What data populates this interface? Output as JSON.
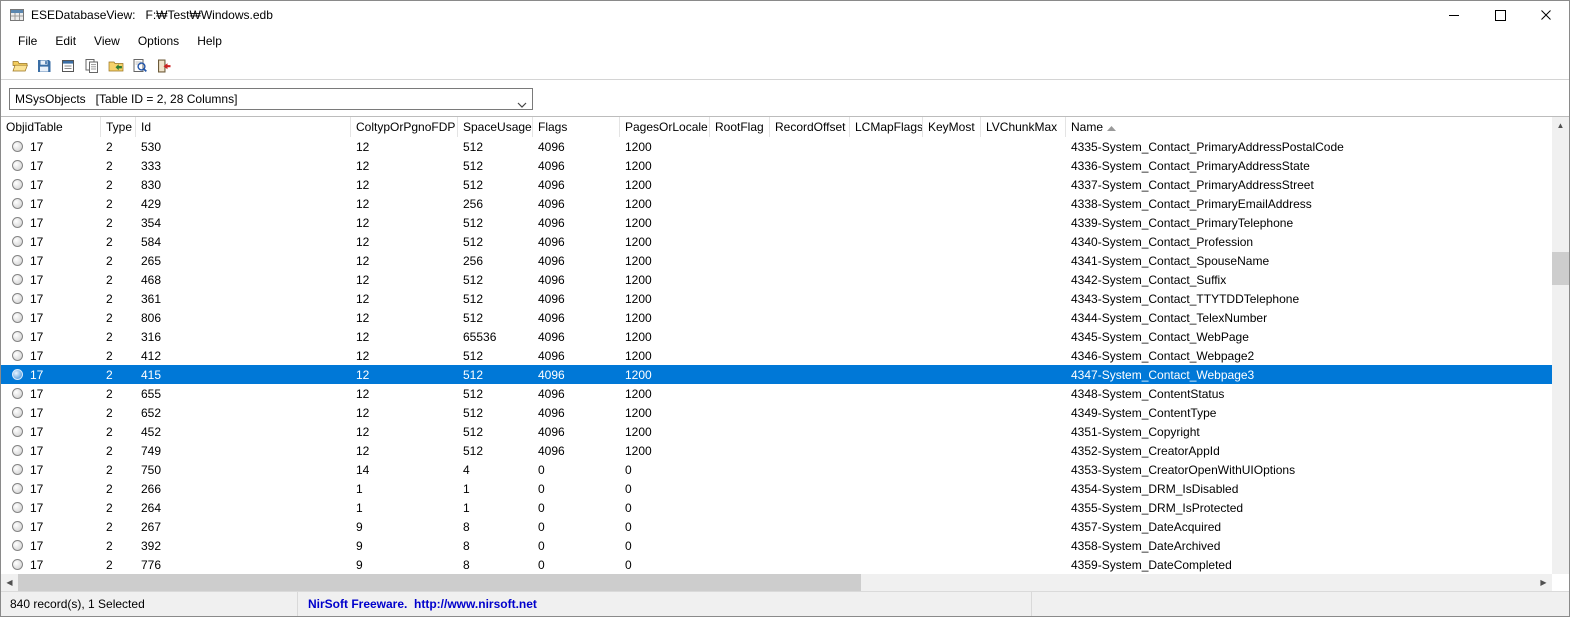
{
  "window": {
    "title": "ESEDatabaseView:   F:₩Test₩Windows.edb"
  },
  "menu": {
    "items": [
      "File",
      "Edit",
      "View",
      "Options",
      "Help"
    ]
  },
  "toolbar": {
    "buttons": [
      "open-file",
      "save-selected-items",
      "database-properties",
      "copy-selected-items",
      "export-selected-items",
      "find",
      "exit"
    ]
  },
  "table_selector": {
    "value": "MSysObjects   [Table ID = 2, 28 Columns]"
  },
  "grid": {
    "columns": [
      "ObjidTable",
      "Type",
      "Id",
      "ColtypOrPgnoFDP",
      "SpaceUsage",
      "Flags",
      "PagesOrLocale",
      "RootFlag",
      "RecordOffset",
      "LCMapFlags",
      "KeyMost",
      "LVChunkMax",
      "Name"
    ],
    "sort_column": "Name",
    "sort_order": "ascending",
    "selected_row_index": 12,
    "rows": [
      [
        "17",
        "2",
        "530",
        "12",
        "512",
        "4096",
        "1200",
        "",
        "",
        "",
        "",
        "",
        "4335-System_Contact_PrimaryAddressPostalCode"
      ],
      [
        "17",
        "2",
        "333",
        "12",
        "512",
        "4096",
        "1200",
        "",
        "",
        "",
        "",
        "",
        "4336-System_Contact_PrimaryAddressState"
      ],
      [
        "17",
        "2",
        "830",
        "12",
        "512",
        "4096",
        "1200",
        "",
        "",
        "",
        "",
        "",
        "4337-System_Contact_PrimaryAddressStreet"
      ],
      [
        "17",
        "2",
        "429",
        "12",
        "256",
        "4096",
        "1200",
        "",
        "",
        "",
        "",
        "",
        "4338-System_Contact_PrimaryEmailAddress"
      ],
      [
        "17",
        "2",
        "354",
        "12",
        "512",
        "4096",
        "1200",
        "",
        "",
        "",
        "",
        "",
        "4339-System_Contact_PrimaryTelephone"
      ],
      [
        "17",
        "2",
        "584",
        "12",
        "512",
        "4096",
        "1200",
        "",
        "",
        "",
        "",
        "",
        "4340-System_Contact_Profession"
      ],
      [
        "17",
        "2",
        "265",
        "12",
        "256",
        "4096",
        "1200",
        "",
        "",
        "",
        "",
        "",
        "4341-System_Contact_SpouseName"
      ],
      [
        "17",
        "2",
        "468",
        "12",
        "512",
        "4096",
        "1200",
        "",
        "",
        "",
        "",
        "",
        "4342-System_Contact_Suffix"
      ],
      [
        "17",
        "2",
        "361",
        "12",
        "512",
        "4096",
        "1200",
        "",
        "",
        "",
        "",
        "",
        "4343-System_Contact_TTYTDDTelephone"
      ],
      [
        "17",
        "2",
        "806",
        "12",
        "512",
        "4096",
        "1200",
        "",
        "",
        "",
        "",
        "",
        "4344-System_Contact_TelexNumber"
      ],
      [
        "17",
        "2",
        "316",
        "12",
        "65536",
        "4096",
        "1200",
        "",
        "",
        "",
        "",
        "",
        "4345-System_Contact_WebPage"
      ],
      [
        "17",
        "2",
        "412",
        "12",
        "512",
        "4096",
        "1200",
        "",
        "",
        "",
        "",
        "",
        "4346-System_Contact_Webpage2"
      ],
      [
        "17",
        "2",
        "415",
        "12",
        "512",
        "4096",
        "1200",
        "",
        "",
        "",
        "",
        "",
        "4347-System_Contact_Webpage3"
      ],
      [
        "17",
        "2",
        "655",
        "12",
        "512",
        "4096",
        "1200",
        "",
        "",
        "",
        "",
        "",
        "4348-System_ContentStatus"
      ],
      [
        "17",
        "2",
        "652",
        "12",
        "512",
        "4096",
        "1200",
        "",
        "",
        "",
        "",
        "",
        "4349-System_ContentType"
      ],
      [
        "17",
        "2",
        "452",
        "12",
        "512",
        "4096",
        "1200",
        "",
        "",
        "",
        "",
        "",
        "4351-System_Copyright"
      ],
      [
        "17",
        "2",
        "749",
        "12",
        "512",
        "4096",
        "1200",
        "",
        "",
        "",
        "",
        "",
        "4352-System_CreatorAppId"
      ],
      [
        "17",
        "2",
        "750",
        "14",
        "4",
        "0",
        "0",
        "",
        "",
        "",
        "",
        "",
        "4353-System_CreatorOpenWithUIOptions"
      ],
      [
        "17",
        "2",
        "266",
        "1",
        "1",
        "0",
        "0",
        "",
        "",
        "",
        "",
        "",
        "4354-System_DRM_IsDisabled"
      ],
      [
        "17",
        "2",
        "264",
        "1",
        "1",
        "0",
        "0",
        "",
        "",
        "",
        "",
        "",
        "4355-System_DRM_IsProtected"
      ],
      [
        "17",
        "2",
        "267",
        "9",
        "8",
        "0",
        "0",
        "",
        "",
        "",
        "",
        "",
        "4357-System_DateAcquired"
      ],
      [
        "17",
        "2",
        "392",
        "9",
        "8",
        "0",
        "0",
        "",
        "",
        "",
        "",
        "",
        "4358-System_DateArchived"
      ],
      [
        "17",
        "2",
        "776",
        "9",
        "8",
        "0",
        "0",
        "",
        "",
        "",
        "",
        "",
        "4359-System_DateCompleted"
      ]
    ]
  },
  "scrollbar": {
    "up": "▲",
    "down": "▼",
    "left": "◀",
    "right": "▶"
  },
  "statusbar": {
    "record_count": "840 record(s), 1 Selected",
    "freeware_link": "NirSoft Freeware.  http://www.nirsoft.net"
  },
  "colors": {
    "selection_background": "#0078d7",
    "selection_text": "#ffffff",
    "link_color": "#0000cc"
  }
}
